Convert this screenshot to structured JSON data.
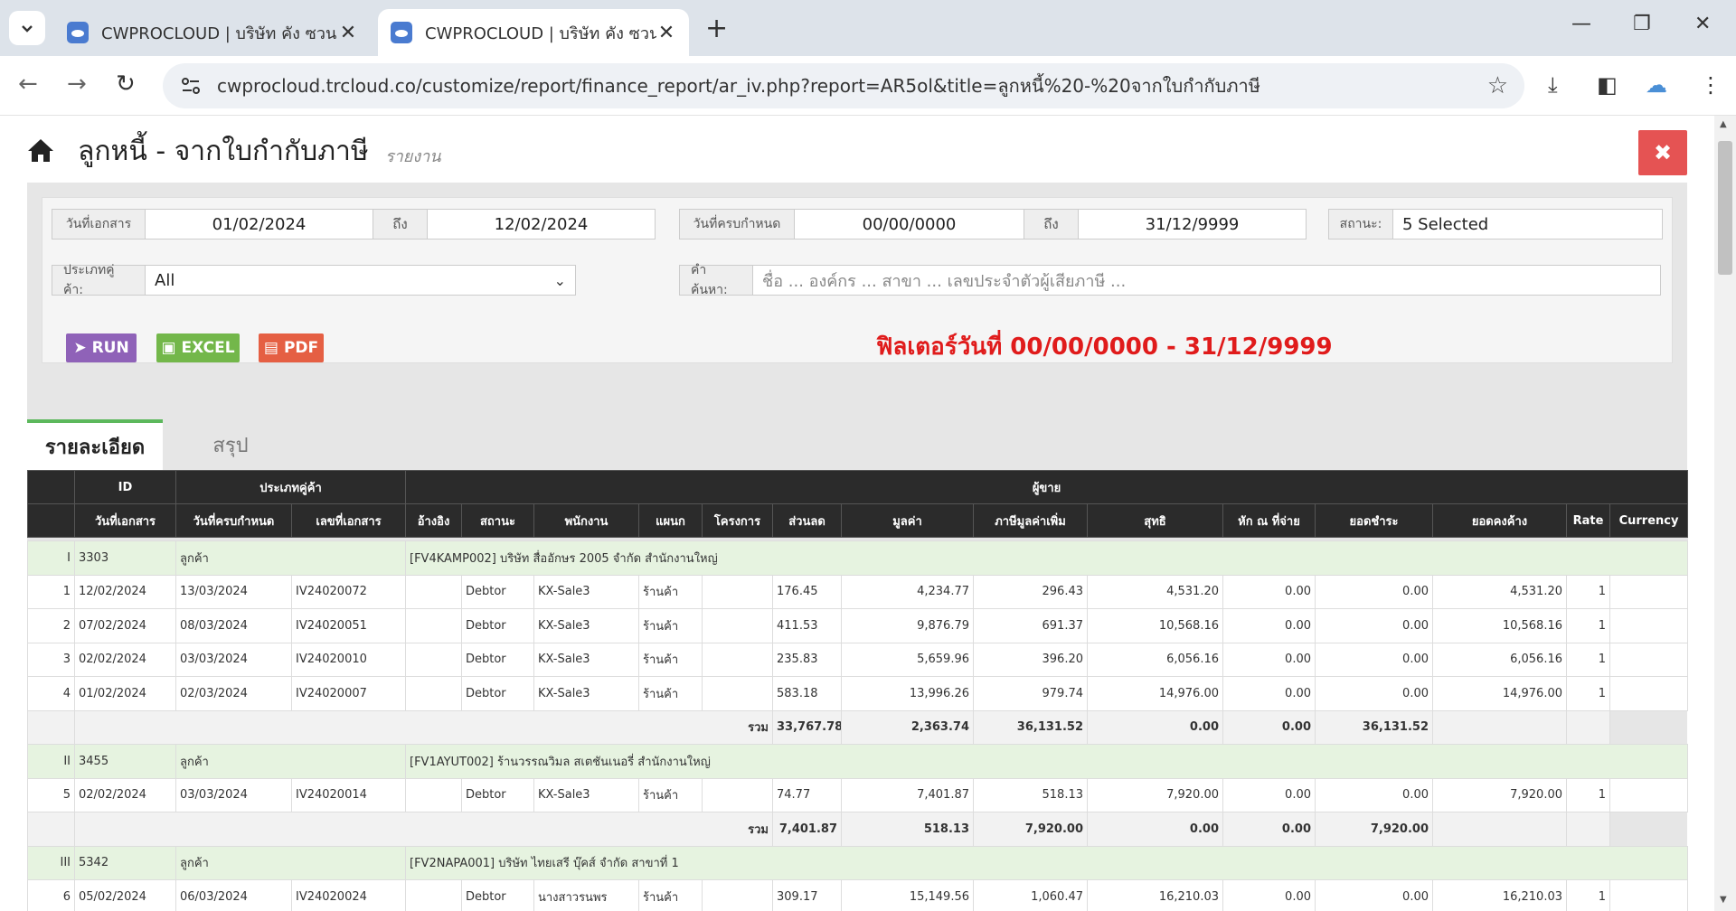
{
  "browser": {
    "tabs": [
      {
        "title": "CWPROCLOUD | บริษัท คัง ซวน วัฒ",
        "active": false
      },
      {
        "title": "CWPROCLOUD | บริษัท คัง ซวน วัฒ",
        "active": true
      }
    ],
    "url": "cwprocloud.trcloud.co/customize/report/finance_report/ar_iv.php?report=AR5ol&title=ลูกหนี้%20-%20จากใบกำกับภาษี"
  },
  "header": {
    "title": "ลูกหนี้ - จากใบกำกับภาษี",
    "subtitle": "รายงาน",
    "close_label": "✖"
  },
  "filters": {
    "doc_date_label": "วันที่เอกสาร",
    "doc_date_from": "01/02/2024",
    "to_label": "ถึง",
    "doc_date_to": "12/02/2024",
    "due_date_label": "วันที่ครบกำหนด",
    "due_date_from": "00/00/0000",
    "due_date_to": "31/12/9999",
    "status_label": "สถานะ:",
    "status_value": "5 Selected",
    "customer_type_label": "ประเภทคู่ค้า:",
    "customer_type_value": "All",
    "search_label": "คำค้นหา:",
    "search_placeholder": "ชื่อ ... องค์กร ... สาขา ... เลขประจำตัวผู้เสียภาษี ..."
  },
  "buttons": {
    "run": "RUN",
    "excel": "EXCEL",
    "pdf": "PDF"
  },
  "filter_note": "ฟิลเตอร์วันที่ 00/00/0000 - 31/12/9999",
  "report_tabs": {
    "detail": "รายละเอียด",
    "summary": "สรุป"
  },
  "table": {
    "head1": {
      "id": "ID",
      "ctype": "ประเภทคู่ค้า",
      "seller": "ผู้ขาย"
    },
    "head2": {
      "doc_date": "วันที่เอกสาร",
      "due_date": "วันที่ครบกำหนด",
      "doc_no": "เลขที่เอกสาร",
      "ref": "อ้างอิง",
      "status": "สถานะ",
      "staff": "พนักงาน",
      "dept": "แผนก",
      "project": "โครงการ",
      "discount": "ส่วนลด",
      "value": "มูลค่า",
      "vat": "ภาษีมูลค่าเพิ่ม",
      "net": "สุทธิ",
      "wht": "หัก ณ ที่จ่าย",
      "paid": "ยอดชำระ",
      "balance": "ยอดคงค้าง",
      "rate": "Rate",
      "currency": "Currency"
    },
    "groups": [
      {
        "roman": "I",
        "id": "3303",
        "ctype": "ลูกค้า",
        "name": "[FV4KAMP002] บริษัท สื่ออักษร 2005 จำกัด สำนักงานใหญ่",
        "rows": [
          {
            "no": "1",
            "doc_date": "12/02/2024",
            "due_date": "13/03/2024",
            "doc_no": "IV24020072",
            "status": "Debtor",
            "staff": "KX-Sale3",
            "dept": "ร้านค้า",
            "discount": "176.45",
            "value": "4,234.77",
            "vat": "296.43",
            "net": "4,531.20",
            "wht": "0.00",
            "paid": "0.00",
            "balance": "4,531.20",
            "rate": "1"
          },
          {
            "no": "2",
            "doc_date": "07/02/2024",
            "due_date": "08/03/2024",
            "doc_no": "IV24020051",
            "status": "Debtor",
            "staff": "KX-Sale3",
            "dept": "ร้านค้า",
            "discount": "411.53",
            "value": "9,876.79",
            "vat": "691.37",
            "net": "10,568.16",
            "wht": "0.00",
            "paid": "0.00",
            "balance": "10,568.16",
            "rate": "1"
          },
          {
            "no": "3",
            "doc_date": "02/02/2024",
            "due_date": "03/03/2024",
            "doc_no": "IV24020010",
            "status": "Debtor",
            "staff": "KX-Sale3",
            "dept": "ร้านค้า",
            "discount": "235.83",
            "value": "5,659.96",
            "vat": "396.20",
            "net": "6,056.16",
            "wht": "0.00",
            "paid": "0.00",
            "balance": "6,056.16",
            "rate": "1"
          },
          {
            "no": "4",
            "doc_date": "01/02/2024",
            "due_date": "02/03/2024",
            "doc_no": "IV24020007",
            "status": "Debtor",
            "staff": "KX-Sale3",
            "dept": "ร้านค้า",
            "discount": "583.18",
            "value": "13,996.26",
            "vat": "979.74",
            "net": "14,976.00",
            "wht": "0.00",
            "paid": "0.00",
            "balance": "14,976.00",
            "rate": "1"
          }
        ],
        "sum": {
          "label": "รวม",
          "value": "33,767.78",
          "vat": "2,363.74",
          "net": "36,131.52",
          "wht": "0.00",
          "paid": "0.00",
          "balance": "36,131.52"
        }
      },
      {
        "roman": "II",
        "id": "3455",
        "ctype": "ลูกค้า",
        "name": "[FV1AYUT002] ร้านวรรณวิมล สเตชันเนอรี่ สำนักงานใหญ่",
        "rows": [
          {
            "no": "5",
            "doc_date": "02/02/2024",
            "due_date": "03/03/2024",
            "doc_no": "IV24020014",
            "status": "Debtor",
            "staff": "KX-Sale3",
            "dept": "ร้านค้า",
            "discount": "74.77",
            "value": "7,401.87",
            "vat": "518.13",
            "net": "7,920.00",
            "wht": "0.00",
            "paid": "0.00",
            "balance": "7,920.00",
            "rate": "1"
          }
        ],
        "sum": {
          "label": "รวม",
          "value": "7,401.87",
          "vat": "518.13",
          "net": "7,920.00",
          "wht": "0.00",
          "paid": "0.00",
          "balance": "7,920.00"
        }
      },
      {
        "roman": "III",
        "id": "5342",
        "ctype": "ลูกค้า",
        "name": "[FV2NAPA001] บริษัท ไทยเสรี บุ๊คส์ จำกัด สาขาที่ 1",
        "rows": [
          {
            "no": "6",
            "doc_date": "05/02/2024",
            "due_date": "06/03/2024",
            "doc_no": "IV24020024",
            "status": "Debtor",
            "staff": "นางสาวรนพร",
            "dept": "ร้านค้า",
            "discount": "309.17",
            "value": "15,149.56",
            "vat": "1,060.47",
            "net": "16,210.03",
            "wht": "0.00",
            "paid": "0.00",
            "balance": "16,210.03",
            "rate": "1"
          }
        ]
      }
    ]
  }
}
